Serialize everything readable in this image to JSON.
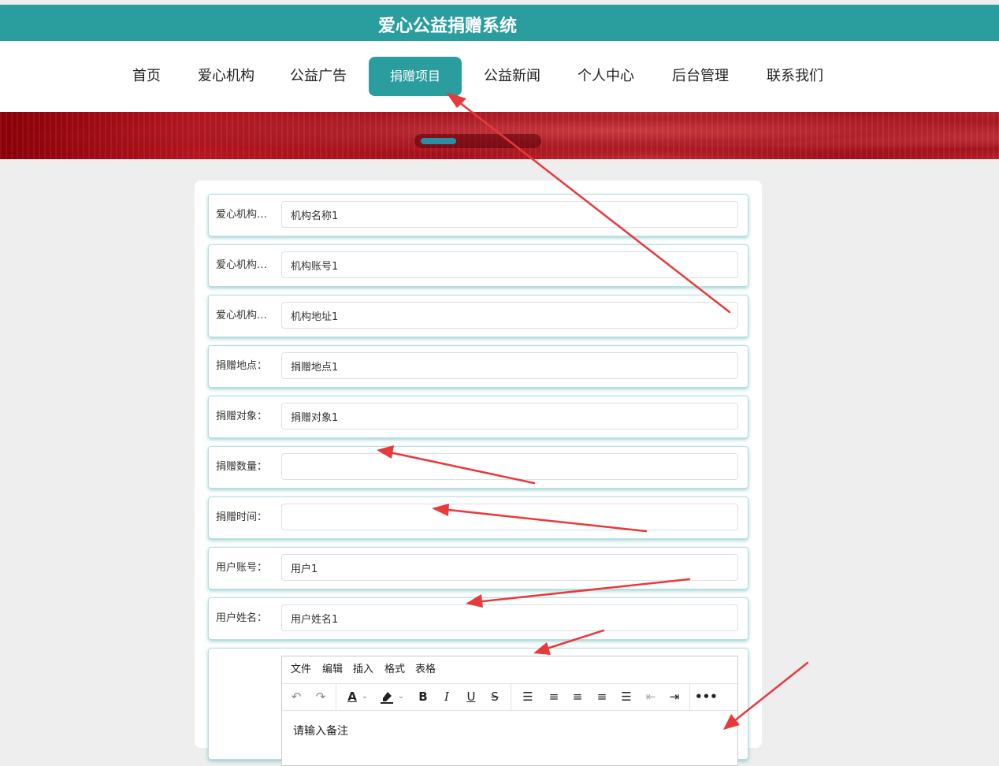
{
  "site": {
    "title": "爱心公益捐赠系统"
  },
  "nav": {
    "items": [
      {
        "label": "首页"
      },
      {
        "label": "爱心机构"
      },
      {
        "label": "公益广告"
      },
      {
        "label": "捐赠项目"
      },
      {
        "label": "公益新闻"
      },
      {
        "label": "个人中心"
      },
      {
        "label": "后台管理"
      },
      {
        "label": "联系我们"
      }
    ]
  },
  "form": {
    "rows": [
      {
        "label": "爱心机构名称：",
        "value": "机构名称1"
      },
      {
        "label": "爱心机构账号：",
        "value": "机构账号1"
      },
      {
        "label": "爱心机构地址：",
        "value": "机构地址1"
      },
      {
        "label": "捐赠地点：",
        "value": "捐赠地点1"
      },
      {
        "label": "捐赠对象：",
        "value": "捐赠对象1"
      },
      {
        "label": "捐赠数量：",
        "value": ""
      },
      {
        "label": "捐赠时间：",
        "value": ""
      },
      {
        "label": "用户账号：",
        "value": "用户1"
      },
      {
        "label": "用户姓名：",
        "value": "用户姓名1"
      }
    ]
  },
  "editor": {
    "menus": [
      "文件",
      "编辑",
      "插入",
      "格式",
      "表格"
    ],
    "placeholder": "请输入备注"
  },
  "colors": {
    "accent": "#2a9d9f",
    "annotation": "#e8393b"
  }
}
